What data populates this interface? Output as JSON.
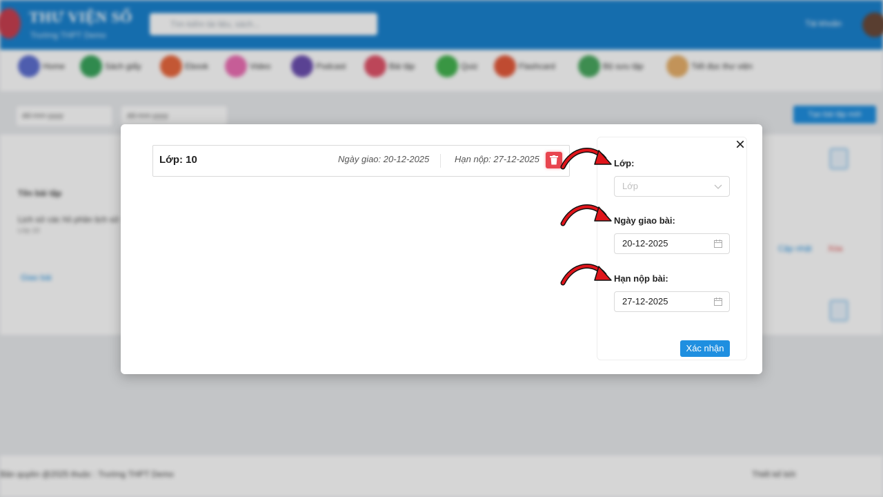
{
  "background": {
    "brand_title": "THƯ VIỆN SỐ",
    "brand_subtitle": "Trường THPT Demo",
    "search_placeholder": "Tìm kiếm tài liệu, sách...",
    "user_link": "Tài khoản",
    "nav_items": [
      "Home",
      "Sách giấy",
      "Ebook",
      "Video",
      "Podcast",
      "Bài tập",
      "Quiz",
      "Flashcard",
      "Bộ sưu tập",
      "Tiết đọc thư viện"
    ],
    "filter_from": "dd-mm-yyyy",
    "filter_to": "dd-mm-yyyy",
    "filter_button": "Tạo bài tập mới",
    "table_header": "Tên bài tập",
    "row_title": "Lịch sử các hồ phần lịch sử",
    "row_sub": "Lớp 10",
    "row_link": "Giao bài",
    "row_action_1": "Cập nhật",
    "row_action_2": "Xóa",
    "footer_left": "Bản quyền @2025 thuộc : Trường THPT Demo",
    "footer_right": "Thiết kế bởi"
  },
  "modal": {
    "class_card": {
      "class_label": "Lớp: 10",
      "assign_date": "Ngày giao: 20-12-2025",
      "due_date": "Hạn nộp: 27-12-2025"
    },
    "form": {
      "class_label": "Lớp:",
      "class_placeholder": "Lớp",
      "assign_label": "Ngày giao bài:",
      "assign_value": "20-12-2025",
      "due_label": "Hạn nộp bài:",
      "due_value": "27-12-2025",
      "confirm_label": "Xác nhận"
    },
    "close_label": "×"
  },
  "colors": {
    "primary": "#1f8fe0",
    "danger": "#e8454f",
    "annotation_arrow": "#e0151b"
  },
  "icons": [
    "close-icon",
    "trash-icon",
    "chevron-down-icon",
    "calendar-icon",
    "annotation-arrow"
  ]
}
